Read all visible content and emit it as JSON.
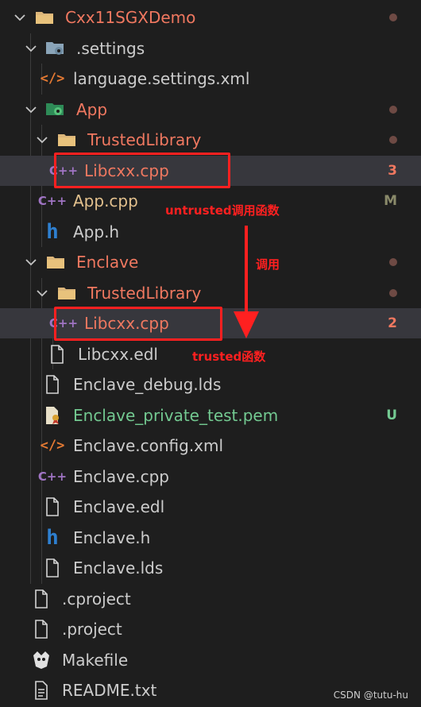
{
  "tree": [
    {
      "label": "Cxx11SGXDemo",
      "kind": "folder",
      "color": "#f07860",
      "decoration": "dot"
    },
    {
      "label": ".settings",
      "kind": "folder-settings",
      "color": "#cccccc",
      "decoration": ""
    },
    {
      "label": "language.settings.xml",
      "kind": "xml",
      "color": "#cccccc",
      "decoration": ""
    },
    {
      "label": "App",
      "kind": "folder-app",
      "color": "#f07860",
      "decoration": "dot"
    },
    {
      "label": "TrustedLibrary",
      "kind": "folder",
      "color": "#f07860",
      "decoration": "dot"
    },
    {
      "label": "Libcxx.cpp",
      "kind": "cpp",
      "color": "#f07860",
      "decoration": "3"
    },
    {
      "label": "App.cpp",
      "kind": "cpp",
      "color": "#e2c08d",
      "decoration": "M"
    },
    {
      "label": "App.h",
      "kind": "h",
      "color": "#cccccc",
      "decoration": ""
    },
    {
      "label": "Enclave",
      "kind": "folder",
      "color": "#f07860",
      "decoration": "dot"
    },
    {
      "label": "TrustedLibrary",
      "kind": "folder",
      "color": "#f07860",
      "decoration": "dot"
    },
    {
      "label": "Libcxx.cpp",
      "kind": "cpp",
      "color": "#f07860",
      "decoration": "2"
    },
    {
      "label": "Libcxx.edl",
      "kind": "file",
      "color": "#cccccc",
      "decoration": ""
    },
    {
      "label": "Enclave_debug.lds",
      "kind": "file",
      "color": "#cccccc",
      "decoration": ""
    },
    {
      "label": "Enclave_private_test.pem",
      "kind": "pem",
      "color": "#73c991",
      "decoration": "U"
    },
    {
      "label": "Enclave.config.xml",
      "kind": "xml",
      "color": "#cccccc",
      "decoration": ""
    },
    {
      "label": "Enclave.cpp",
      "kind": "cpp",
      "color": "#cccccc",
      "decoration": ""
    },
    {
      "label": "Enclave.edl",
      "kind": "file",
      "color": "#cccccc",
      "decoration": ""
    },
    {
      "label": "Enclave.h",
      "kind": "h",
      "color": "#cccccc",
      "decoration": ""
    },
    {
      "label": "Enclave.lds",
      "kind": "file",
      "color": "#cccccc",
      "decoration": ""
    },
    {
      "label": ".cproject",
      "kind": "file",
      "color": "#cccccc",
      "decoration": ""
    },
    {
      "label": ".project",
      "kind": "file",
      "color": "#cccccc",
      "decoration": ""
    },
    {
      "label": "Makefile",
      "kind": "makefile",
      "color": "#cccccc",
      "decoration": ""
    },
    {
      "label": "README.txt",
      "kind": "txt",
      "color": "#cccccc",
      "decoration": ""
    }
  ],
  "annotations": {
    "untrusted_call": "untrusted调用函数",
    "call": "调用",
    "trusted_func": "trusted函数"
  },
  "watermark": "CSDN @tutu-hu",
  "colors": {
    "modified": "#e2c08d",
    "untracked": "#73c991",
    "error": "#f07860",
    "annotation": "#ff2020"
  }
}
